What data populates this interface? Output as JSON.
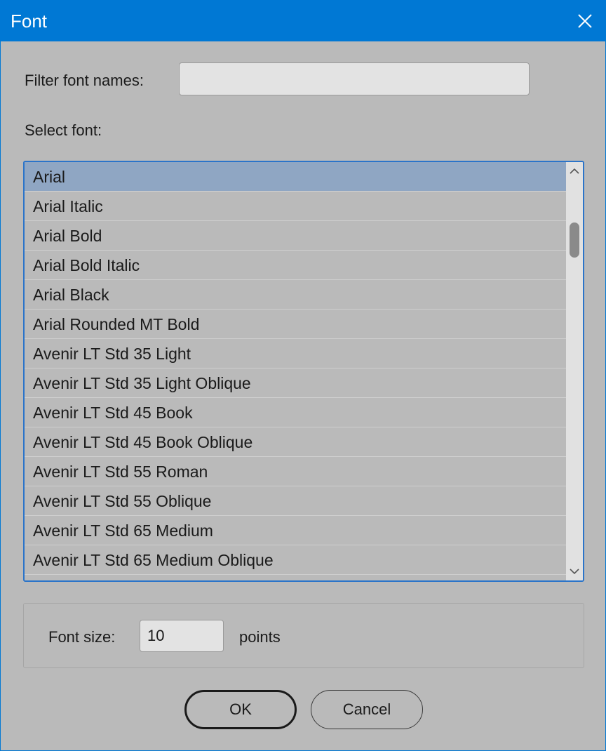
{
  "window": {
    "title": "Font",
    "accent_color": "#0078d4",
    "close_icon": "close-icon"
  },
  "filter": {
    "label": "Filter font names:",
    "value": ""
  },
  "font_list": {
    "label": "Select font:",
    "selected_index": 0,
    "items": [
      "Arial",
      "Arial Italic",
      "Arial Bold",
      "Arial Bold Italic",
      "Arial Black",
      "Arial Rounded MT Bold",
      "Avenir LT Std 35 Light",
      "Avenir LT Std 35 Light Oblique",
      "Avenir LT Std 45 Book",
      "Avenir LT Std 45 Book Oblique",
      "Avenir LT Std 55 Roman",
      "Avenir LT Std 55 Oblique",
      "Avenir LT Std 65 Medium",
      "Avenir LT Std 65 Medium Oblique"
    ]
  },
  "font_size": {
    "label": "Font size:",
    "value": "10",
    "unit": "points"
  },
  "buttons": {
    "ok": "OK",
    "cancel": "Cancel"
  }
}
